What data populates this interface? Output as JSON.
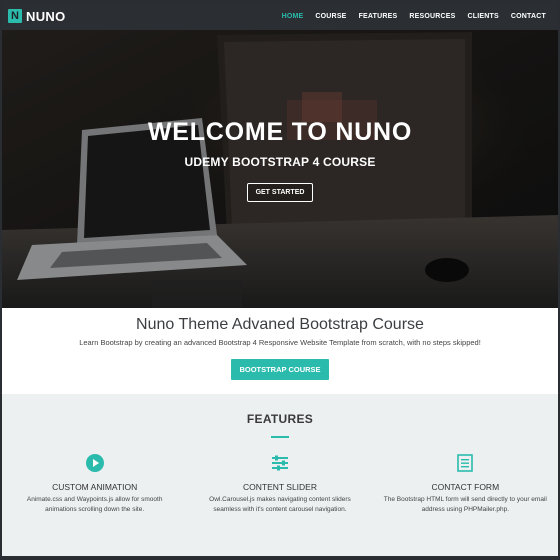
{
  "brand": {
    "logo_letter": "N",
    "name": "NUNO"
  },
  "nav": {
    "items": [
      {
        "label": "HOME",
        "active": true
      },
      {
        "label": "COURSE",
        "active": false
      },
      {
        "label": "FEATURES",
        "active": false
      },
      {
        "label": "RESOURCES",
        "active": false
      },
      {
        "label": "CLIENTS",
        "active": false
      },
      {
        "label": "CONTACT",
        "active": false
      }
    ]
  },
  "hero": {
    "title": "WELCOME TO NUNO",
    "subtitle": "UDEMY BOOTSTRAP 4 COURSE",
    "button_label": "GET STARTED"
  },
  "course": {
    "title": "Nuno Theme Advaned Bootstrap Course",
    "description": "Learn Bootstrap by creating an advanced Bootstrap 4 Responsive Website Template from scratch, with no steps skipped!",
    "button_label": "BOOTSTRAP COURSE"
  },
  "features": {
    "title": "FEATURES",
    "items": [
      {
        "icon": "play-circle-icon",
        "title": "CUSTOM ANIMATION",
        "text": "Animate.css and Waypoints.js allow for smooth animations scrolling down the site."
      },
      {
        "icon": "sliders-icon",
        "title": "CONTENT SLIDER",
        "text": "Owl.Carousel.js makes navigating content sliders seamless with it's content carousel navigation."
      },
      {
        "icon": "form-icon",
        "title": "CONTACT FORM",
        "text": "The Bootstrap HTML form will send directly to your email address using PHPMailer.php."
      }
    ]
  },
  "colors": {
    "accent": "#2bbbad",
    "navbar": "#2b2f33",
    "features_bg": "#ecf0f1"
  }
}
